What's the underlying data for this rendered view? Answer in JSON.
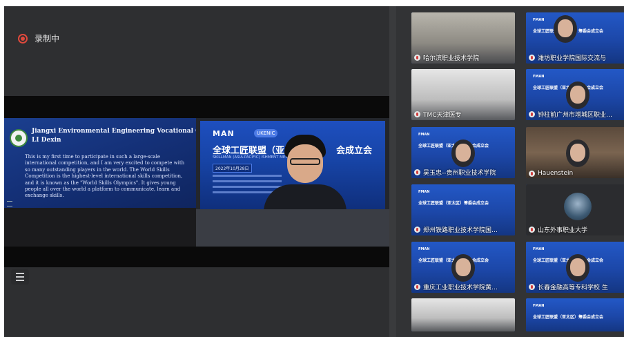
{
  "recording": {
    "label": "录制中",
    "indicator_color": "#e0493c"
  },
  "share": {
    "slide_left": {
      "title": "Jiangxi Environmental Engineering Vocational College",
      "name": "LI Dexin",
      "paragraph": "This is my first time to participate in such a large-scale international competition, and I am very excited to compete with so many outstanding players in the world. The World Skills Competition is the highest-level international skills competition, and it is known as the \"World Skills Olympics\". It gives young people all over the world a platform to communicate, learn and exchange skills."
    },
    "slide_video": {
      "brand": "MAN",
      "brand_tag": "UKENIC",
      "heading": "全球工匠联盟（亚太",
      "heading_tail": "会成立会",
      "subtitle": "SKILLMAN (ASIA-PACIFIC)            ISHMENT MEETING",
      "date_pill": "2022年10月28日"
    }
  },
  "participants": [
    {
      "label": "哈尔滨职业技术学院",
      "bg": "roombg"
    },
    {
      "label": "潍坊职业学院国际交流与",
      "bg": "bluebg"
    },
    {
      "label": "TMC天津医专",
      "bg": "lightroom"
    },
    {
      "label": "钟柱前广州市增城区职业…",
      "bg": "bluebg"
    },
    {
      "label": "吴玉忠--贵州职业技术学院",
      "bg": "bluebg"
    },
    {
      "label": "Hauenstein",
      "bg": "shelfbg"
    },
    {
      "label": "郑州铁路职业技术学院国…",
      "bg": "bluebg"
    },
    {
      "label": "山东外事职业大学",
      "bg": "darkbg"
    },
    {
      "label": "重庆工业职业技术学院黄…",
      "bg": "bluebg"
    },
    {
      "label": "长春金融高等专科学校 生",
      "bg": "bluebg"
    },
    {
      "label": "",
      "bg": "lightroom"
    },
    {
      "label": "",
      "bg": "bluebg"
    }
  ],
  "tile_slide_text": {
    "title": "全球工匠联盟（亚太区）筹委会成立会",
    "brand": "FMAN"
  }
}
